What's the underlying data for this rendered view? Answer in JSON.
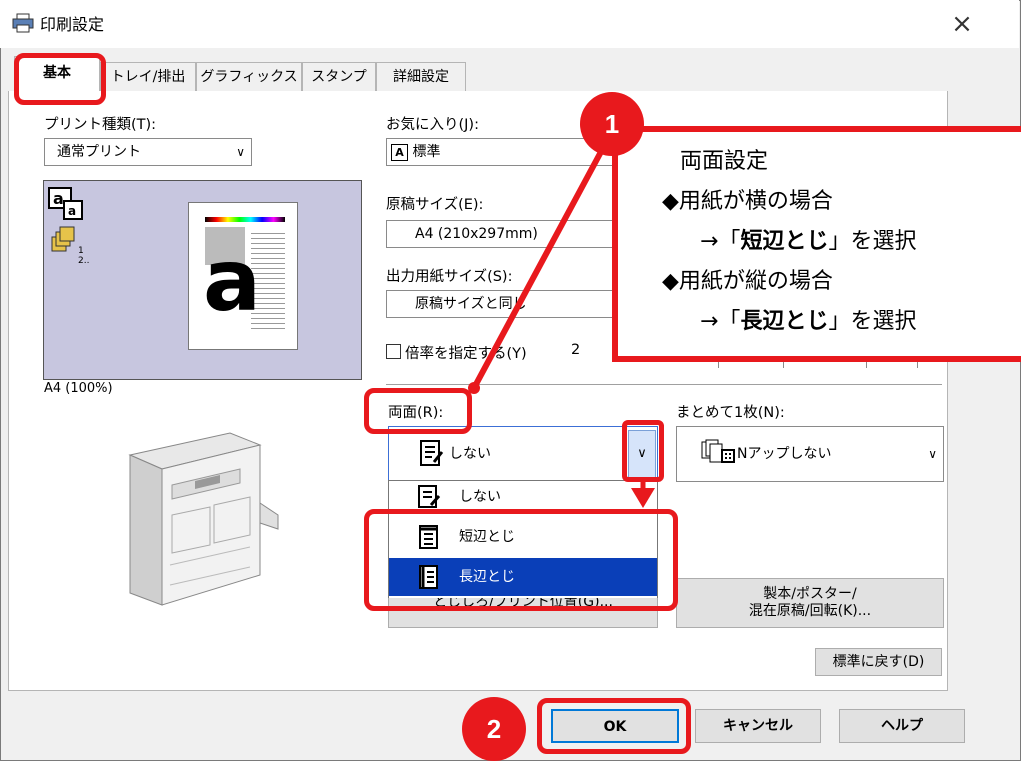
{
  "window": {
    "title": "印刷設定",
    "close": "×"
  },
  "tabs": [
    {
      "label": "基本"
    },
    {
      "label": "トレイ/排出"
    },
    {
      "label": "グラフィックス"
    },
    {
      "label": "スタンプ"
    },
    {
      "label": "詳細設定"
    }
  ],
  "print_type": {
    "label": "プリント種類(T):",
    "value": "通常プリント"
  },
  "preview": {
    "caption": "A4 (100%)",
    "big_letter": "a",
    "mini_letter": "a",
    "count_text": "12.."
  },
  "favorites": {
    "label": "お気に入り(J):",
    "value": "標準",
    "icon_letter": "A"
  },
  "original_size": {
    "label": "原稿サイズ(E):",
    "value": "A4 (210x297mm)"
  },
  "output_size": {
    "label": "出力用紙サイズ(S):",
    "value": "原稿サイズと同じ"
  },
  "scale": {
    "label": "倍率を指定する(Y)",
    "value": "2"
  },
  "duplex": {
    "label": "両面(R):",
    "value": "しない",
    "options": [
      {
        "label": "しない",
        "selected": false
      },
      {
        "label": "短辺とじ",
        "selected": false
      },
      {
        "label": "長辺とじ",
        "selected": true
      }
    ]
  },
  "nup": {
    "label": "まとめて1枚(N):",
    "value": "Nアップしない"
  },
  "buttons": {
    "hidden_behind": "とじしろ/プリント位置(G)...",
    "booklet_line1": "製本/ポスター/",
    "booklet_line2": "混在原稿/回転(K)...",
    "restore": "標準に戻す(D)",
    "ok": "OK",
    "cancel": "キャンセル",
    "help": "ヘルプ"
  },
  "annotations": {
    "step1": "1",
    "step2": "2",
    "callout_title": "両面設定",
    "line1": "◆用紙が横の場合",
    "line2_prefix": "→「",
    "line2_bold": "短辺とじ",
    "line2_suffix": "」を選択",
    "line3": "◆用紙が縦の場合",
    "line4_prefix": "→「",
    "line4_bold": "長辺とじ",
    "line4_suffix": "」を選択"
  },
  "colors": {
    "accent_red": "#e8191d",
    "selection_blue": "#0a3fb8",
    "preview_bg": "#c7c6df"
  }
}
